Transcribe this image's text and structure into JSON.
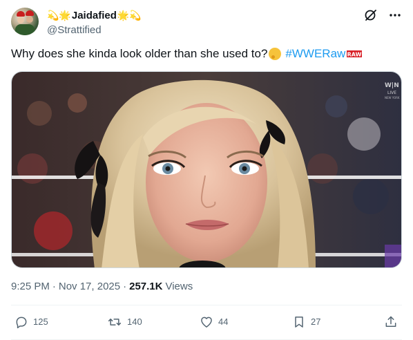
{
  "author": {
    "display_name": "Jaidafied",
    "name_emojis_left": "💫🌟",
    "name_emojis_right": "🌟💫",
    "handle": "@Strattified"
  },
  "tweet": {
    "text": "Why does she kinda look older than she used to?",
    "hashtag": "#WWERaw",
    "hashtag_logo": "RAW"
  },
  "media": {
    "watermark": "LIVE",
    "watermark_sub": "NEW YORK"
  },
  "meta": {
    "time": "9:25 PM",
    "separator": "·",
    "date": "Nov 17, 2025",
    "views_count": "257.1K",
    "views_label": "Views"
  },
  "actions": {
    "replies": "125",
    "reposts": "140",
    "likes": "44",
    "bookmarks": "27"
  },
  "icons": {
    "grok": "grok-icon",
    "more": "more-icon",
    "reply": "reply-icon",
    "repost": "repost-icon",
    "like": "heart-icon",
    "bookmark": "bookmark-icon",
    "share": "share-icon"
  },
  "colors": {
    "text": "#0f1419",
    "secondary": "#536471",
    "link": "#1d9bf0",
    "divider": "#eff3f4"
  }
}
